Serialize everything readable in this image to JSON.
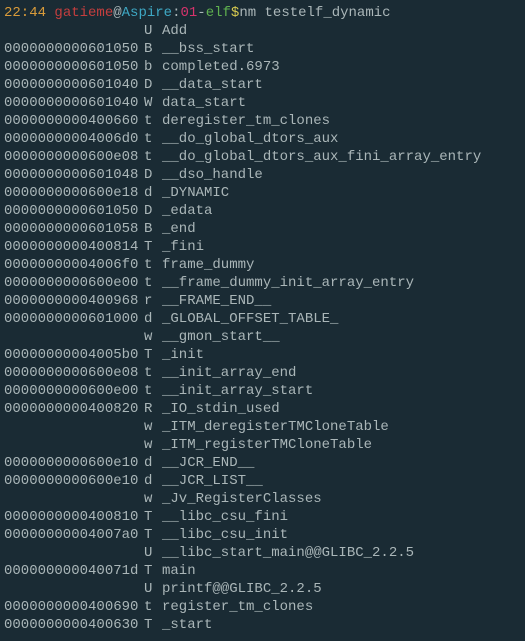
{
  "prompt": {
    "time": "22:44",
    "user": "gatieme",
    "at": "@",
    "host": "Aspire",
    "colon": ":",
    "path": "01",
    "dash": "-",
    "dir": "elf",
    "dollar": " $",
    "cmd": "nm testelf_dynamic"
  },
  "rows": [
    {
      "addr": "",
      "type": "U",
      "name": "Add"
    },
    {
      "addr": "0000000000601050",
      "type": "B",
      "name": "__bss_start"
    },
    {
      "addr": "0000000000601050",
      "type": "b",
      "name": "completed.6973"
    },
    {
      "addr": "0000000000601040",
      "type": "D",
      "name": "__data_start"
    },
    {
      "addr": "0000000000601040",
      "type": "W",
      "name": "data_start"
    },
    {
      "addr": "0000000000400660",
      "type": "t",
      "name": "deregister_tm_clones"
    },
    {
      "addr": "00000000004006d0",
      "type": "t",
      "name": "__do_global_dtors_aux"
    },
    {
      "addr": "0000000000600e08",
      "type": "t",
      "name": "__do_global_dtors_aux_fini_array_entry"
    },
    {
      "addr": "0000000000601048",
      "type": "D",
      "name": "__dso_handle"
    },
    {
      "addr": "0000000000600e18",
      "type": "d",
      "name": "_DYNAMIC"
    },
    {
      "addr": "0000000000601050",
      "type": "D",
      "name": "_edata"
    },
    {
      "addr": "0000000000601058",
      "type": "B",
      "name": "_end"
    },
    {
      "addr": "0000000000400814",
      "type": "T",
      "name": "_fini"
    },
    {
      "addr": "00000000004006f0",
      "type": "t",
      "name": "frame_dummy"
    },
    {
      "addr": "0000000000600e00",
      "type": "t",
      "name": "__frame_dummy_init_array_entry"
    },
    {
      "addr": "0000000000400968",
      "type": "r",
      "name": "__FRAME_END__"
    },
    {
      "addr": "0000000000601000",
      "type": "d",
      "name": "_GLOBAL_OFFSET_TABLE_"
    },
    {
      "addr": "",
      "type": "w",
      "name": "__gmon_start__"
    },
    {
      "addr": "00000000004005b0",
      "type": "T",
      "name": "_init"
    },
    {
      "addr": "0000000000600e08",
      "type": "t",
      "name": "__init_array_end"
    },
    {
      "addr": "0000000000600e00",
      "type": "t",
      "name": "__init_array_start"
    },
    {
      "addr": "0000000000400820",
      "type": "R",
      "name": "_IO_stdin_used"
    },
    {
      "addr": "",
      "type": "w",
      "name": "_ITM_deregisterTMCloneTable"
    },
    {
      "addr": "",
      "type": "w",
      "name": "_ITM_registerTMCloneTable"
    },
    {
      "addr": "0000000000600e10",
      "type": "d",
      "name": "__JCR_END__"
    },
    {
      "addr": "0000000000600e10",
      "type": "d",
      "name": "__JCR_LIST__"
    },
    {
      "addr": "",
      "type": "w",
      "name": "_Jv_RegisterClasses"
    },
    {
      "addr": "0000000000400810",
      "type": "T",
      "name": "__libc_csu_fini"
    },
    {
      "addr": "00000000004007a0",
      "type": "T",
      "name": "__libc_csu_init"
    },
    {
      "addr": "",
      "type": "U",
      "name": "__libc_start_main@@GLIBC_2.2.5"
    },
    {
      "addr": "000000000040071d",
      "type": "T",
      "name": "main"
    },
    {
      "addr": "",
      "type": "U",
      "name": "printf@@GLIBC_2.2.5"
    },
    {
      "addr": "0000000000400690",
      "type": "t",
      "name": "register_tm_clones"
    },
    {
      "addr": "0000000000400630",
      "type": "T",
      "name": "_start"
    }
  ]
}
